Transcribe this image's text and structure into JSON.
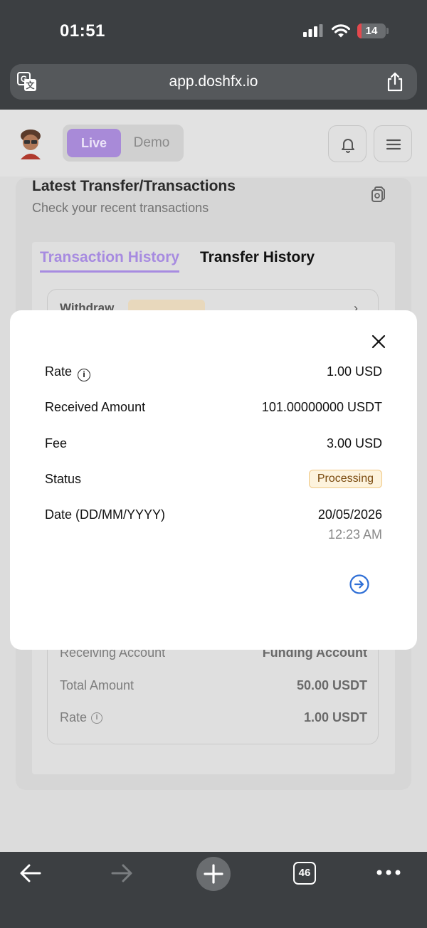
{
  "status_bar": {
    "time": "01:51",
    "battery": "14",
    "battery_level": 0.14,
    "battery_color": "#e5484d"
  },
  "browser": {
    "url": "app.doshfx.io",
    "icons": [
      "translate-icon",
      "share-icon"
    ],
    "tab_count": "46"
  },
  "app": {
    "mode_toggle": {
      "live": "Live",
      "demo": "Demo",
      "selected": "Live"
    },
    "section_title": "Latest Transfer/Transactions",
    "section_subtitle": "Check your recent transactions",
    "tabs": [
      {
        "label": "Transaction History",
        "active": true
      },
      {
        "label": "Transfer History",
        "active": false
      }
    ],
    "transaction": {
      "type": "Withdraw",
      "status": "Processing",
      "rows": [
        {
          "label": "Receiving Account",
          "value": "Funding Account"
        },
        {
          "label": "Total Amount",
          "value": "50.00 USDT"
        },
        {
          "label": "Rate",
          "value": "1.00 USDT"
        }
      ]
    },
    "accent_color": "#a78be0"
  },
  "modal": {
    "rate_label": "Rate",
    "rate_value": "1.00 USD",
    "received_label": "Received Amount",
    "received_value": "101.00000000 USDT",
    "fee_label": "Fee",
    "fee_value": "3.00 USD",
    "status_label": "Status",
    "status_value": "Processing",
    "date_label": "Date (DD/MM/YYYY)",
    "date_value": "20/05/2026",
    "time_value": "12:23 AM",
    "link_color": "#2f6fd6"
  }
}
